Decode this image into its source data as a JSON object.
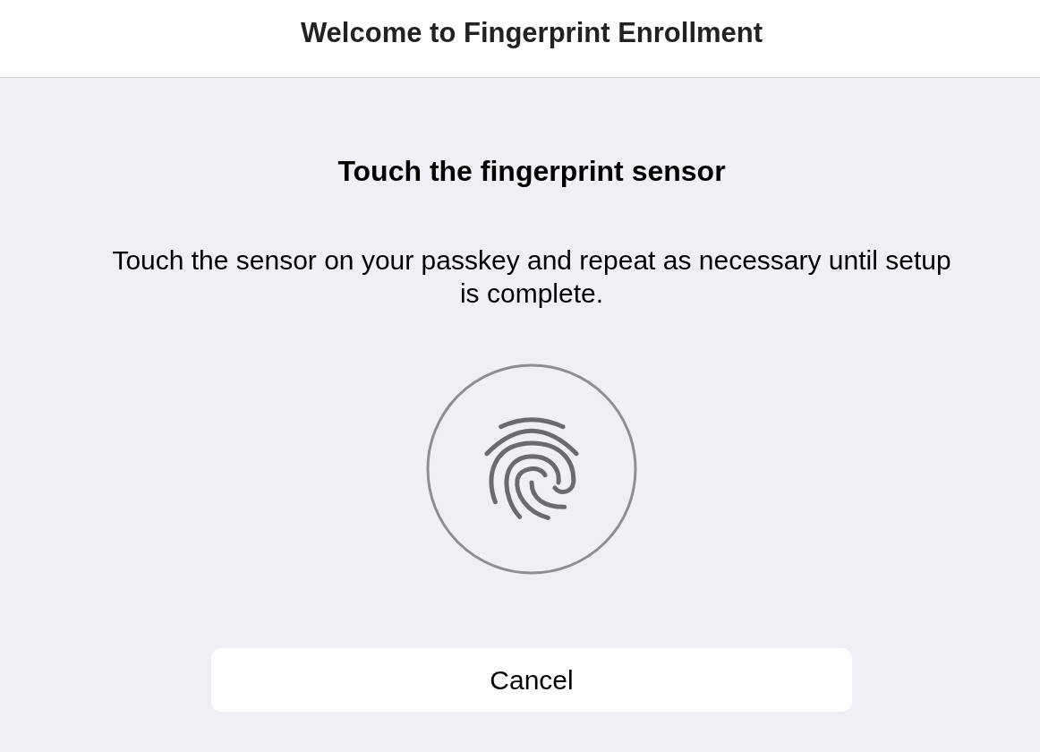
{
  "header": {
    "title": "Welcome to Fingerprint Enrollment"
  },
  "prompt": {
    "heading": "Touch the fingerprint sensor",
    "description": "Touch the sensor on your passkey and repeat as necessary until setup is complete."
  },
  "buttons": [
    {
      "label": "Cancel"
    }
  ]
}
